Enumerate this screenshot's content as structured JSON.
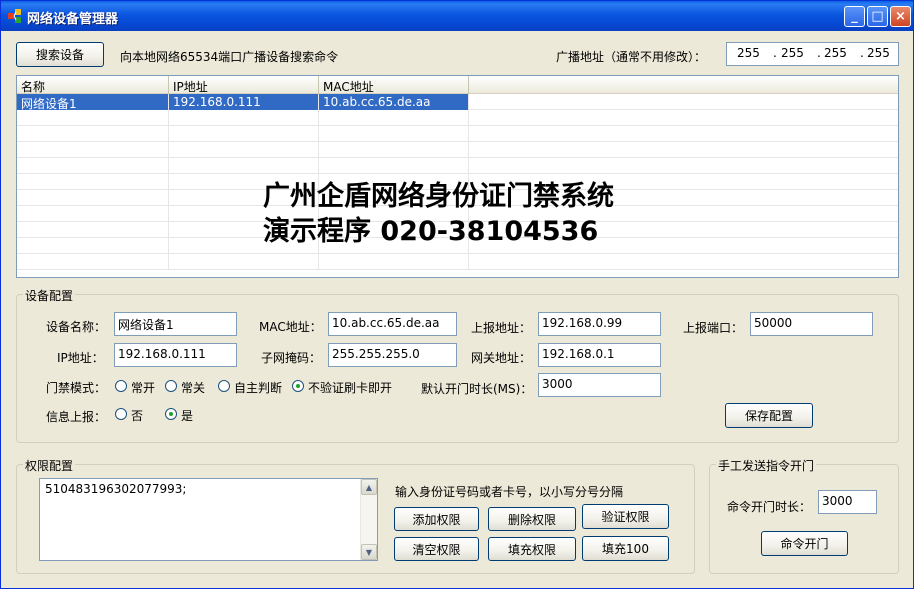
{
  "window": {
    "title": "网络设备管理器",
    "minimize": "_",
    "maximize": "□",
    "close": "×"
  },
  "toolbar": {
    "search_button": "搜索设备",
    "broadcast_hint": "向本地网络65534端口广播设备搜索命令",
    "broadcast_label": "广播地址（通常不用修改）：",
    "broadcast_address": [
      "255",
      "255",
      "255",
      "255"
    ]
  },
  "device_list": {
    "columns": [
      "名称",
      "IP地址",
      "MAC地址"
    ],
    "rows": [
      {
        "name": "网络设备1",
        "ip": "192.168.0.111",
        "mac": "10.ab.cc.65.de.aa",
        "selected": true
      }
    ]
  },
  "overlay": {
    "line1": "广州企盾网络身份证门禁系统",
    "line2": "演示程序 020-38104536"
  },
  "device_config": {
    "title": "设备配置",
    "device_name_label": "设备名称：",
    "device_name": "网络设备1",
    "mac_label": "MAC地址：",
    "mac": "10.ab.cc.65.de.aa",
    "report_addr_label": "上报地址：",
    "report_addr": "192.168.0.99",
    "report_port_label": "上报端口：",
    "report_port": "50000",
    "ip_label": "IP地址：",
    "ip": "192.168.0.111",
    "subnet_label": "子网掩码：",
    "subnet": "255.255.255.0",
    "gateway_label": "网关地址：",
    "gateway": "192.168.0.1",
    "door_mode_label": "门禁模式：",
    "door_modes": [
      "常开",
      "常关",
      "自主判断",
      "不验证刷卡即开"
    ],
    "door_mode_selected": 3,
    "open_time_label": "默认开门时长(MS)：",
    "open_time": "3000",
    "info_report_label": "信息上报：",
    "info_report_options": [
      "否",
      "是"
    ],
    "info_report_selected": 1,
    "save_button": "保存配置"
  },
  "permission_config": {
    "title": "权限配置",
    "content": "510483196302077993;",
    "hint": "输入身份证号码或者卡号，以小写分号分隔",
    "add_button": "添加权限",
    "delete_button": "删除权限",
    "verify_button": "验证权限",
    "clear_button": "清空权限",
    "fill_button": "填充权限",
    "fill100_button": "填充100"
  },
  "manual_open": {
    "title": "手工发送指令开门",
    "duration_label": "命令开门时长：",
    "duration": "3000",
    "open_button": "命令开门"
  }
}
